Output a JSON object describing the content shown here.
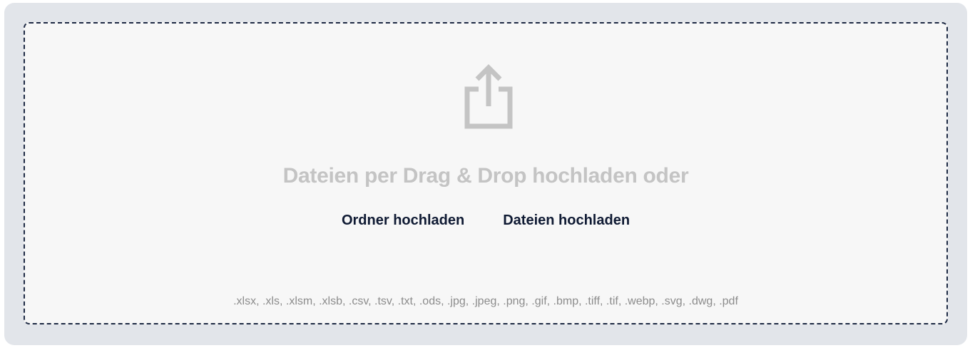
{
  "dropzone": {
    "icon": "upload-icon",
    "headline": "Dateien per Drag & Drop hochladen oder",
    "folder_button_label": "Ordner hochladen",
    "files_button_label": "Dateien hochladen",
    "accepted_formats": ".xlsx, .xls, .xlsm, .xlsb, .csv, .tsv, .txt, .ods, .jpg, .jpeg, .png, .gif, .bmp, .tiff, .tif, .webp, .svg, .dwg, .pdf"
  },
  "colors": {
    "outer_background": "#e2e5ea",
    "dropzone_background": "#f7f7f7",
    "border": "#1e2a44",
    "headline": "#c4c4c4",
    "button_text": "#0f1a33",
    "formats_text": "#8c8c8c",
    "icon": "#c4c4c4"
  }
}
